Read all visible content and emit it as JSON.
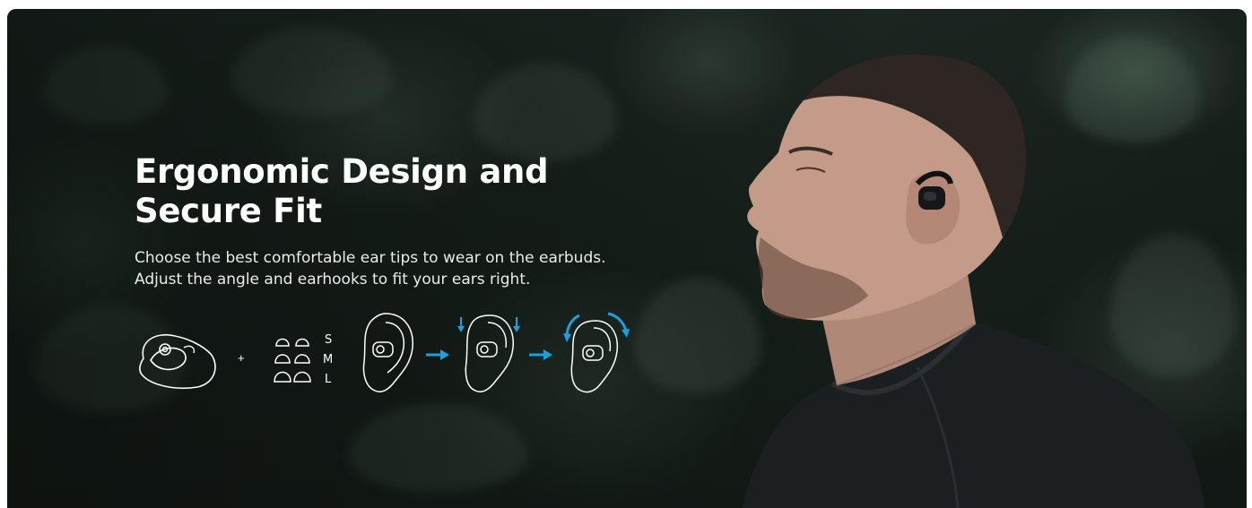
{
  "banner": {
    "headline_line1": "Ergonomic Design and",
    "headline_line2": "Secure Fit",
    "sub_line1": "Choose the best comfortable ear tips to wear on the earbuds.",
    "sub_line2": "Adjust the angle and earhooks to fit your ears right."
  },
  "steps": {
    "plus": "+",
    "sizes": [
      "S",
      "M",
      "L"
    ]
  },
  "colors": {
    "text": "#ffffff",
    "arrow": "#1a9fe0",
    "background": "#18211c"
  }
}
